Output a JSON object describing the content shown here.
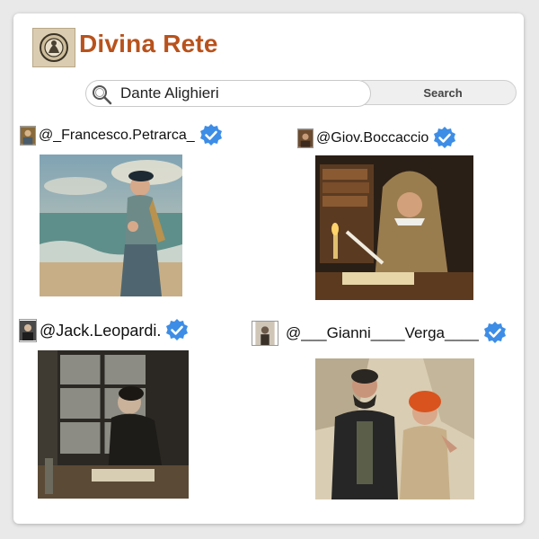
{
  "app": {
    "title": "Divina Rete",
    "accent_color": "#b8521c"
  },
  "search": {
    "value": "Dante Alighieri",
    "button_label": "Search"
  },
  "profiles": [
    {
      "handle": "@_Francesco.Petrarca_",
      "verified": true,
      "avatar_icon": "portrait-avatar",
      "image": "renaissance man standing on beach"
    },
    {
      "handle": "@Giov.Boccaccio",
      "verified": true,
      "avatar_icon": "portrait-avatar",
      "image": "hooded writer with quill by candlelight"
    },
    {
      "handle": "@Jack.Leopardi.",
      "verified": true,
      "avatar_icon": "portrait-avatar",
      "image": "man seated by rainy window"
    },
    {
      "handle": "@___Gianni____Verga____",
      "verified": true,
      "avatar_icon": "portrait-avatar",
      "image": "bearded man with red-haired boy"
    }
  ],
  "colors": {
    "verified_badge": "#3d8de6",
    "card_bg": "#ffffff",
    "page_bg": "#e9e9e9"
  }
}
